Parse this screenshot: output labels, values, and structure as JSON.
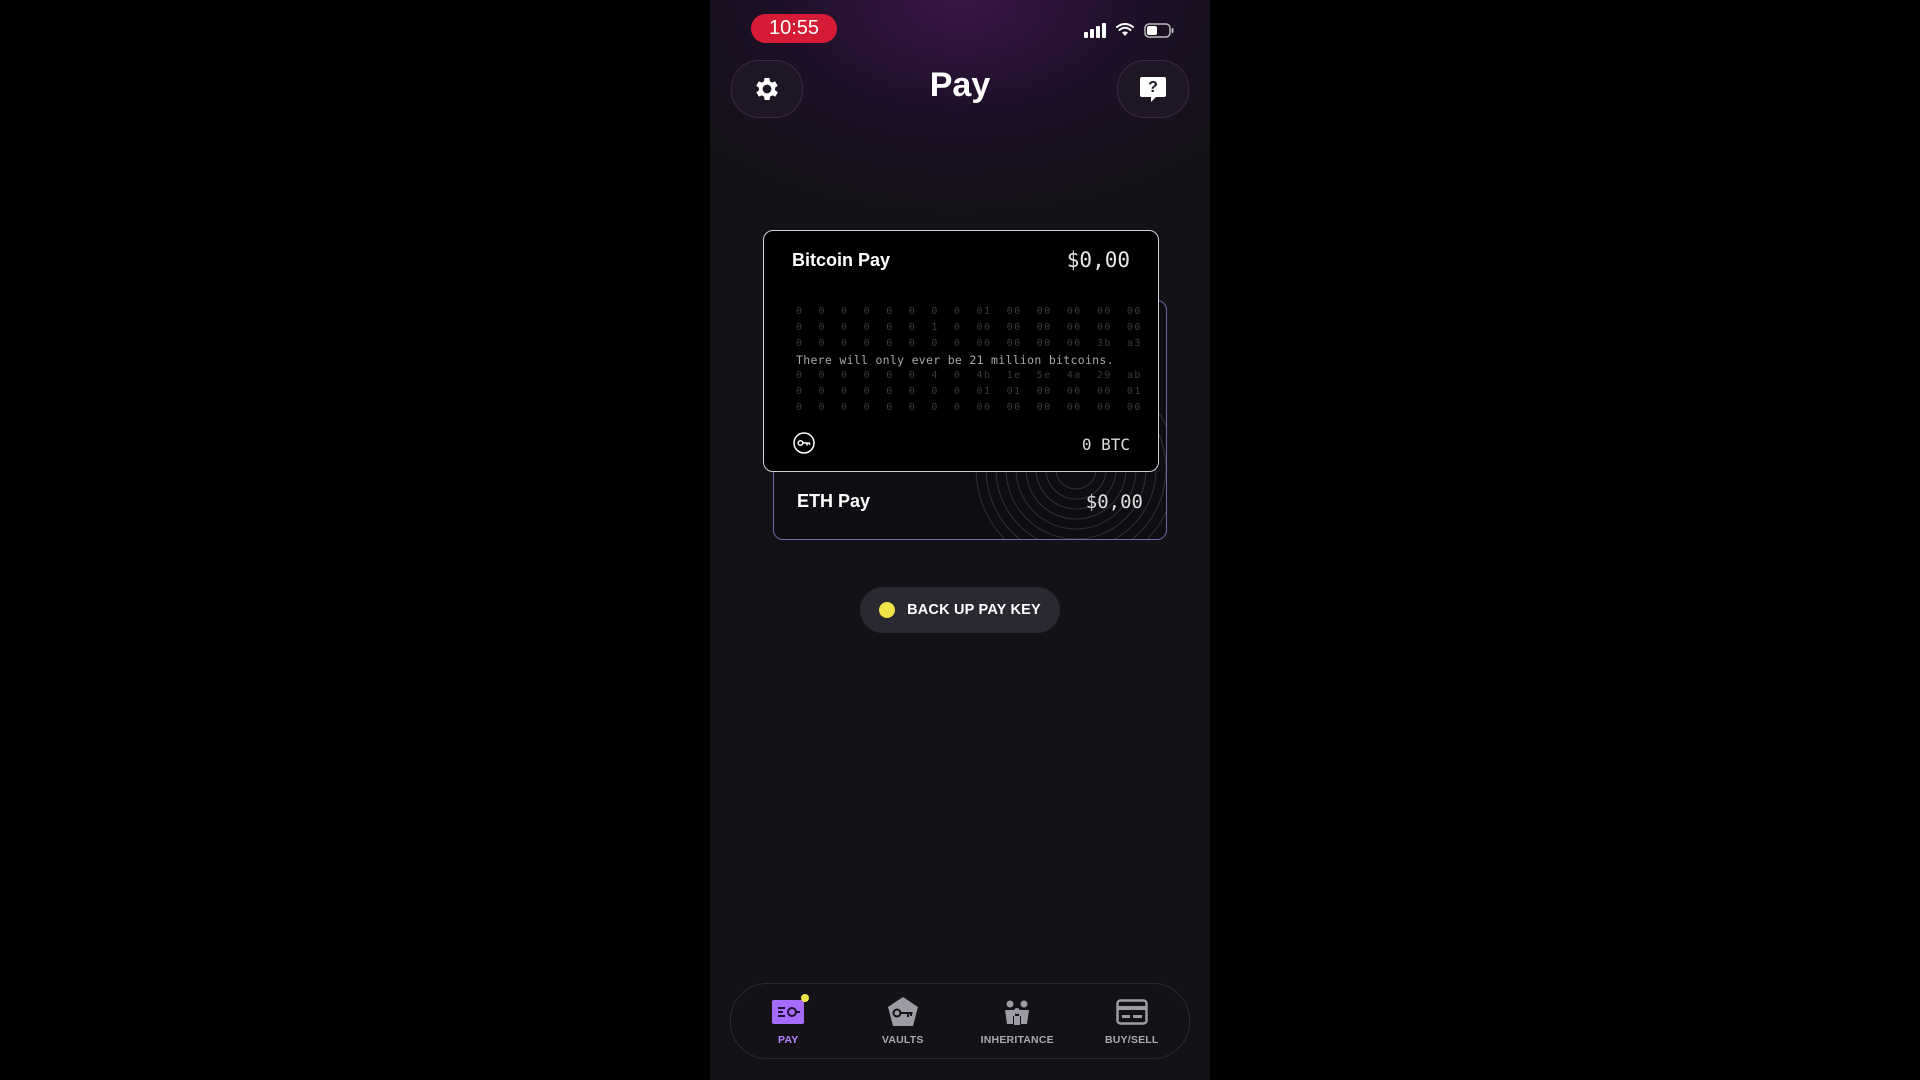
{
  "status": {
    "time": "10:55"
  },
  "header": {
    "title": "Pay"
  },
  "cards": {
    "bitcoin": {
      "name": "Bitcoin Pay",
      "fiat_value": "$0,00",
      "crypto_value": "0 BTC",
      "message": "There will only ever be 21 million bitcoins."
    },
    "eth": {
      "name": "ETH Pay",
      "fiat_value": "$0,00"
    }
  },
  "backup": {
    "label": "BACK UP PAY KEY",
    "dot_color": "#f1e54a"
  },
  "tabs": [
    {
      "label": "PAY",
      "icon": "pay-card-icon",
      "active": true
    },
    {
      "label": "VAULTS",
      "icon": "vault-key-icon",
      "active": false
    },
    {
      "label": "INHERITANCE",
      "icon": "family-icon",
      "active": false
    },
    {
      "label": "BUY/SELL",
      "icon": "credit-card-icon",
      "active": false
    }
  ],
  "colors": {
    "accent": "#b583ff",
    "status_time_bg": "#d51b36",
    "indicator": "#f1e54a"
  }
}
